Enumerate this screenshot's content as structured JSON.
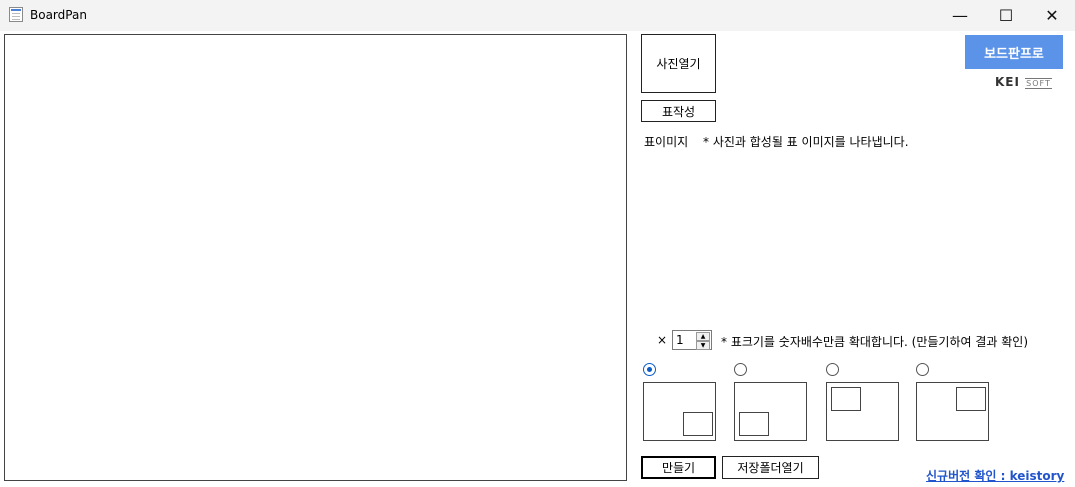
{
  "window": {
    "title": "BoardPan",
    "minimize": "—",
    "maximize": "☐",
    "close": "✕"
  },
  "buttons": {
    "open_photo": "사진열기",
    "make_table": "표작성",
    "pro": "보드판프로",
    "create": "만들기",
    "open_save_folder": "저장폴더열기"
  },
  "logo": {
    "main": "KEI",
    "sub": "SOFT"
  },
  "table_image": {
    "label": "표이미지",
    "hint": "* 사진과 합성될 표 이미지를 나타냅니다."
  },
  "scale": {
    "multiply_sign": "×",
    "value": "1",
    "up": "▲",
    "down": "▼",
    "hint": "* 표크기를 숫자배수만큼 확대합니다. (만들기하여 결과 확인)"
  },
  "position_options": [
    {
      "id": "bottom-right",
      "checked": true
    },
    {
      "id": "bottom-left",
      "checked": false
    },
    {
      "id": "top-left",
      "checked": false
    },
    {
      "id": "top-right",
      "checked": false
    }
  ],
  "link": {
    "text": "신규버전 확인 : keistory"
  },
  "colors": {
    "accent": "#5b93e8",
    "link": "#2255cc",
    "radio": "#0a5cc8"
  }
}
